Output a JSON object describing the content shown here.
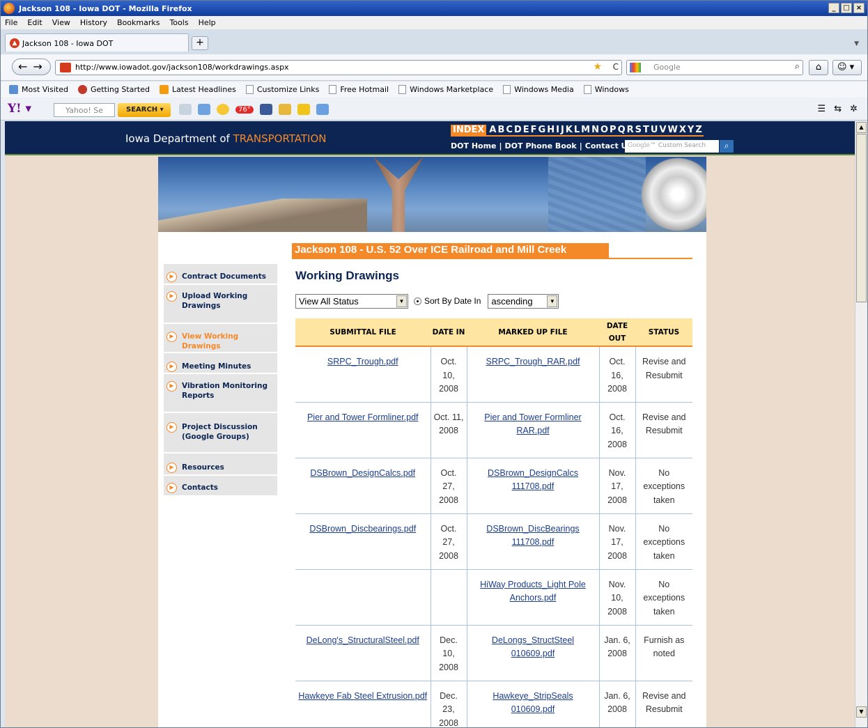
{
  "window": {
    "title": "Jackson 108 - Iowa DOT - Mozilla Firefox"
  },
  "menu": [
    "File",
    "Edit",
    "View",
    "History",
    "Bookmarks",
    "Tools",
    "Help"
  ],
  "tab": {
    "label": "Jackson 108 - Iowa DOT",
    "new_tab": "+"
  },
  "nav": {
    "url": "http://www.iowadot.gov/jackson108/workdrawings.aspx",
    "search_placeholder": "Google"
  },
  "bookmarks": [
    "Most Visited",
    "Getting Started",
    "Latest Headlines",
    "Customize Links",
    "Free Hotmail",
    "Windows Marketplace",
    "Windows Media",
    "Windows"
  ],
  "yahoo": {
    "search_placeholder": "Yahoo! Se",
    "search_button": "SEARCH",
    "weather": "76°"
  },
  "site": {
    "dept_prefix": "Iowa Department of",
    "dept_suffix": "TRANSPORTATION",
    "index_label": "INDEX",
    "letters": [
      "A",
      "B",
      "C",
      "D",
      "E",
      "F",
      "G",
      "H",
      "I",
      "J",
      "K",
      "L",
      "M",
      "N",
      "O",
      "P",
      "Q",
      "R",
      "S",
      "T",
      "U",
      "V",
      "W",
      "X",
      "Y",
      "Z"
    ],
    "top_links": [
      "DOT Home",
      "|",
      "DOT Phone Book",
      "|",
      "Contact Us"
    ],
    "custom_search": "Custom Search",
    "google": "Google"
  },
  "project_title": "Jackson 108 - U.S. 52 Over ICE Railroad and Mill Creek",
  "sidenav": [
    {
      "label": "Contract Documents"
    },
    {
      "label": "Upload Working Drawings"
    },
    {
      "label": "View Working Drawings"
    },
    {
      "label": "Meeting Minutes"
    },
    {
      "label": "Vibration Monitoring Reports"
    },
    {
      "label": "Project Discussion (Google Groups)"
    },
    {
      "label": "Resources"
    },
    {
      "label": "Contacts"
    }
  ],
  "page_title": "Working Drawings",
  "filters": {
    "status": "View All Status",
    "sort_label": "Sort By Date In",
    "order": "ascending"
  },
  "table": {
    "headers": [
      "SUBMITTAL FILE",
      "DATE IN",
      "MARKED UP FILE",
      "DATE OUT",
      "STATUS"
    ],
    "rows": [
      [
        "SRPC_Trough.pdf",
        "Oct. 10, 2008",
        "SRPC_Trough_RAR.pdf",
        "Oct. 16, 2008",
        "Revise and Resubmit"
      ],
      [
        "Pier and Tower Formliner.pdf",
        "Oct. 11, 2008",
        "Pier and Tower Formliner RAR.pdf",
        "Oct. 16, 2008",
        "Revise and Resubmit"
      ],
      [
        "DSBrown_DesignCalcs.pdf",
        "Oct. 27, 2008",
        "DSBrown_DesignCalcs 111708.pdf",
        "Nov. 17, 2008",
        "No exceptions taken"
      ],
      [
        "DSBrown_Discbearings.pdf",
        "Oct. 27, 2008",
        "DSBrown_DiscBearings 111708.pdf",
        "Nov. 17, 2008",
        "No exceptions taken"
      ],
      [
        "",
        "",
        "HiWay Products_Light Pole Anchors.pdf",
        "Nov. 10, 2008",
        "No exceptions taken"
      ],
      [
        "DeLong's_StructuralSteel.pdf",
        "Dec. 10, 2008",
        "DeLongs_StructSteel 010609.pdf",
        "Jan. 6, 2008",
        "Furnish as noted"
      ],
      [
        "Hawkeye Fab Steel Extrusion.pdf",
        "Dec. 23, 2008",
        "Hawkeye_StripSeals 010609.pdf",
        "Jan. 6, 2008",
        "Revise and Resubmit"
      ]
    ]
  }
}
